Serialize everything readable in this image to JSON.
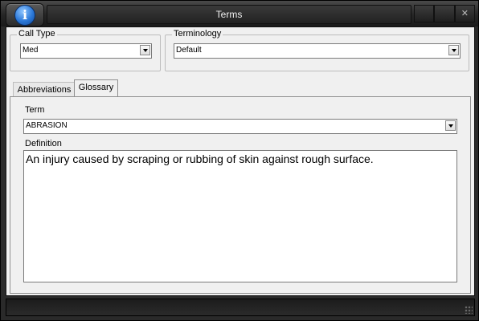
{
  "window": {
    "title": "Terms",
    "controls": {
      "minimize": "",
      "maximize": "",
      "close": "✕"
    }
  },
  "call_type": {
    "label": "Call Type",
    "value": "Med"
  },
  "terminology": {
    "label": "Terminology",
    "value": "Default"
  },
  "tabs": [
    {
      "label": "Abbreviations",
      "active": false
    },
    {
      "label": "Glossary",
      "active": true
    }
  ],
  "glossary": {
    "term_label": "Term",
    "term_value": "ABRASION",
    "definition_label": "Definition",
    "definition_value": "An injury caused by scraping or rubbing of skin against rough surface."
  },
  "colors": {
    "accent": "#2b78d8",
    "chrome": "#2a2a2a",
    "client": "#f0f0f0"
  }
}
